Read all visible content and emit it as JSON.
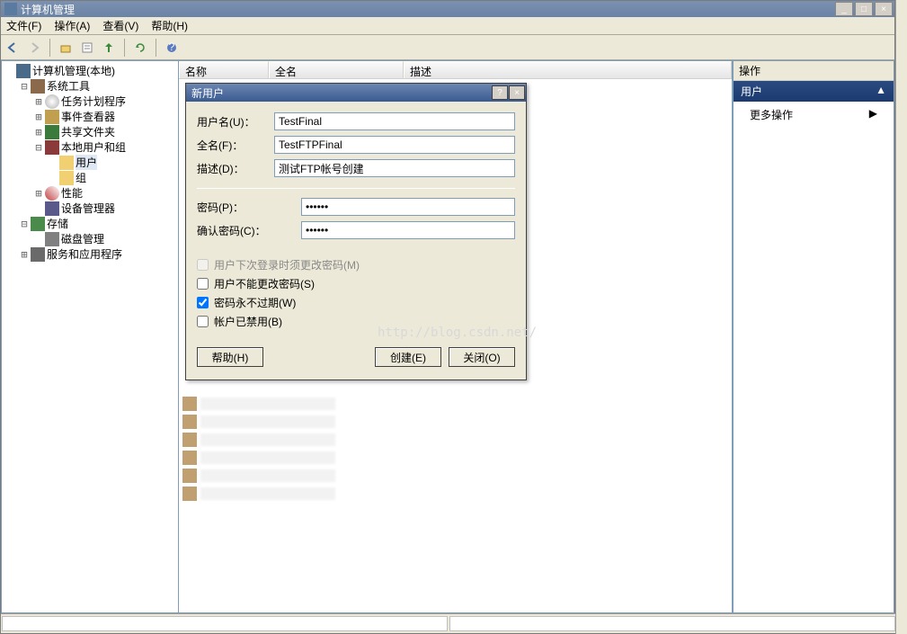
{
  "window": {
    "title": "计算机管理"
  },
  "winbuttons": {
    "min": "_",
    "max": "□",
    "close": "×"
  },
  "menu": {
    "file": "文件(F)",
    "action": "操作(A)",
    "view": "查看(V)",
    "help": "帮助(H)"
  },
  "tree": {
    "root": "计算机管理(本地)",
    "sys_tools": "系统工具",
    "task_sched": "任务计划程序",
    "event_viewer": "事件查看器",
    "shared_folders": "共享文件夹",
    "local_users_groups": "本地用户和组",
    "users": "用户",
    "groups": "组",
    "performance": "性能",
    "device_mgr": "设备管理器",
    "storage": "存储",
    "disk_mgmt": "磁盘管理",
    "services_apps": "服务和应用程序"
  },
  "list_headers": {
    "name": "名称",
    "fullname": "全名",
    "desc": "描述"
  },
  "right_pane": {
    "header": "操作",
    "section": "用户",
    "more": "更多操作"
  },
  "dialog": {
    "title": "新用户",
    "label_username": "用户名(U)：",
    "label_fullname": "全名(F)：",
    "label_desc": "描述(D)：",
    "label_password": "密码(P)：",
    "label_confirm": "确认密码(C)：",
    "val_username": "TestFinal",
    "val_fullname": "TestFTPFinal",
    "val_desc": "测试FTP帐号创建",
    "val_password": "••••••",
    "val_confirm": "••••••",
    "chk1": "用户下次登录时须更改密码(M)",
    "chk2": "用户不能更改密码(S)",
    "chk3": "密码永不过期(W)",
    "chk4": "帐户已禁用(B)",
    "btn_help": "帮助(H)",
    "btn_create": "创建(E)",
    "btn_close": "关闭(O)",
    "help_q": "?",
    "close_x": "×"
  },
  "watermark": "http://blog.csdn.net/"
}
